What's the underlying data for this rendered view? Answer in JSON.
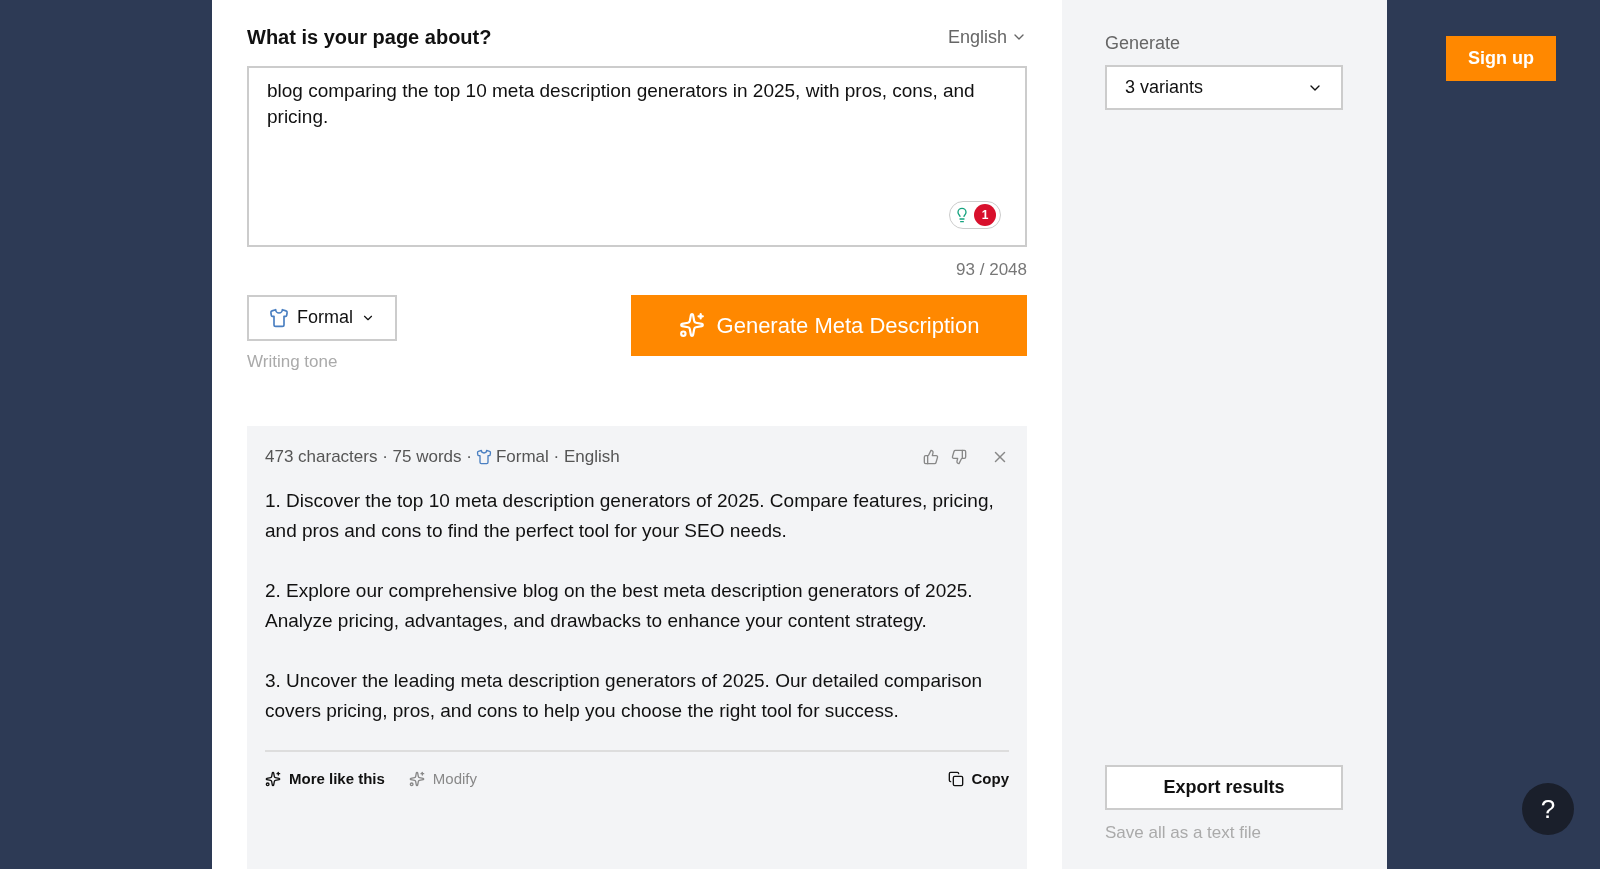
{
  "form": {
    "title": "What is your page about?",
    "language": "English",
    "input": "blog comparing the top 10 meta description generators in 2025, with pros, cons, and pricing.",
    "spelling_badge": "1",
    "counter": "93 / 2048",
    "tone": "Formal",
    "tone_label": "Writing tone",
    "generate_button": "Generate Meta Description"
  },
  "result": {
    "stats": "473 characters · 75 words ·",
    "tone": "Formal · English",
    "paragraphs": [
      "1. Discover the top 10 meta description generators of 2025. Compare features, pricing, and pros and cons to find the perfect tool for your SEO needs.",
      "2. Explore our comprehensive blog on the best meta description generators of 2025. Analyze pricing, advantages, and drawbacks to enhance your content strategy.",
      "3. Uncover the leading meta description generators of 2025. Our detailed comparison covers pricing, pros, and cons to help you choose the right tool for success."
    ],
    "actions": [
      {
        "label": "More like this",
        "kind": "primary",
        "disabled": false
      },
      {
        "label": "Modify",
        "kind": "primary",
        "disabled": true
      },
      {
        "label": "Copy",
        "kind": "copy",
        "disabled": false
      }
    ]
  },
  "settings": {
    "label": "Generate",
    "variants": "3 variants",
    "export_button": "Export results",
    "export_hint": "Save all as a text file"
  },
  "signup_button": "Sign up",
  "help_button": "?"
}
